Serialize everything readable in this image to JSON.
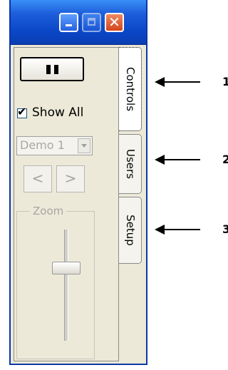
{
  "window": {
    "titlebar": {
      "minimize_icon": "minimize-icon",
      "maximize_icon": "maximize-icon",
      "close_icon": "close-icon",
      "close_glyph": "✕",
      "colors": {
        "titlebar": "#0a47c8",
        "close": "#d3441c"
      }
    }
  },
  "controls": {
    "pause_icon": "pause-icon",
    "show_all": {
      "label": "Show All",
      "checked": true,
      "tick": "✔"
    },
    "demo_select": {
      "value": "Demo 1",
      "enabled": false
    },
    "prev_label": "<",
    "next_label": ">",
    "zoom": {
      "legend": "Zoom"
    }
  },
  "tabs": [
    {
      "label": "Controls",
      "selected": true
    },
    {
      "label": "Users",
      "selected": false
    },
    {
      "label": "Setup",
      "selected": false
    }
  ],
  "annotations": [
    {
      "number": "1"
    },
    {
      "number": "2"
    },
    {
      "number": "3"
    }
  ]
}
